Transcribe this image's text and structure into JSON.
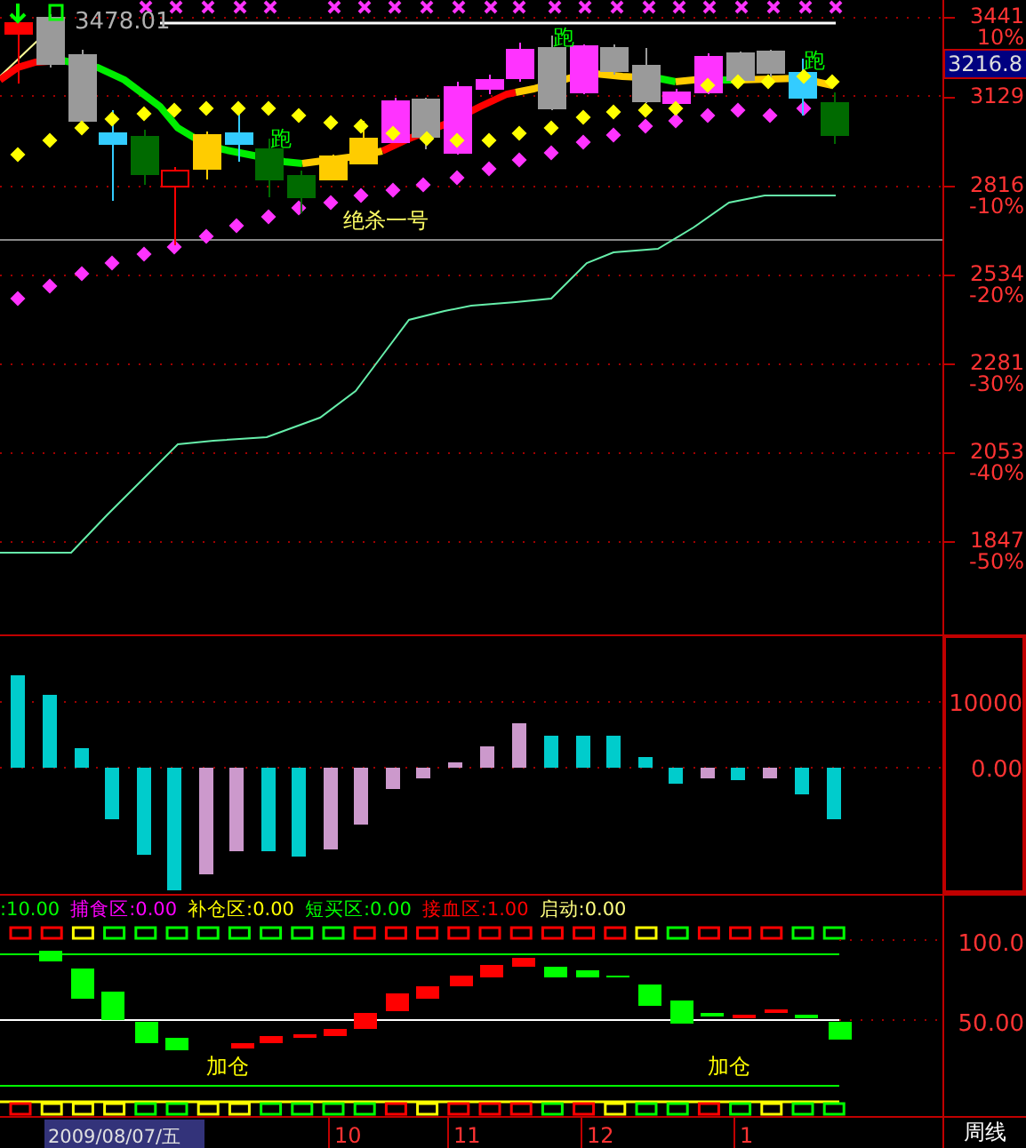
{
  "price_panel": {
    "high_label": "3478.01",
    "current_price": "3216.8",
    "signals": [
      {
        "text": "跑"
      },
      {
        "text": "跑"
      },
      {
        "text": "跑"
      }
    ],
    "strategy_label": "绝杀一号",
    "axis_labels": [
      {
        "price": "3441",
        "percent": "10%"
      },
      {
        "price": "3129"
      },
      {
        "price": "2816",
        "percent": "-10%"
      },
      {
        "price": "2534",
        "percent": "-20%"
      },
      {
        "price": "2281",
        "percent": "-30%"
      },
      {
        "price": "2053",
        "percent": "-40%"
      },
      {
        "price": "1847",
        "percent": "-50%"
      }
    ]
  },
  "oscillator_panel": {
    "axis_labels": [
      "10000",
      "0.00"
    ]
  },
  "indicator_panel": {
    "legend": [
      {
        "text": ":10.00",
        "color": "#00ff00"
      },
      {
        "text": "捕食区:0.00",
        "color": "#ff00ff"
      },
      {
        "text": "补仓区:0.00",
        "color": "#ffff00"
      },
      {
        "text": "短买区:0.00",
        "color": "#00ff00"
      },
      {
        "text": "接血区:1.00",
        "color": "#ff0000"
      },
      {
        "text": "启动:0.00",
        "color": "#ffff80"
      }
    ],
    "annotations": [
      "加仓",
      "加仓"
    ],
    "axis_labels": [
      "100.0",
      "50.00"
    ]
  },
  "time_axis": {
    "cursor_date": "2009/08/07/五",
    "labels": [
      "10",
      "11",
      "12",
      "1"
    ],
    "period": "周线"
  }
}
